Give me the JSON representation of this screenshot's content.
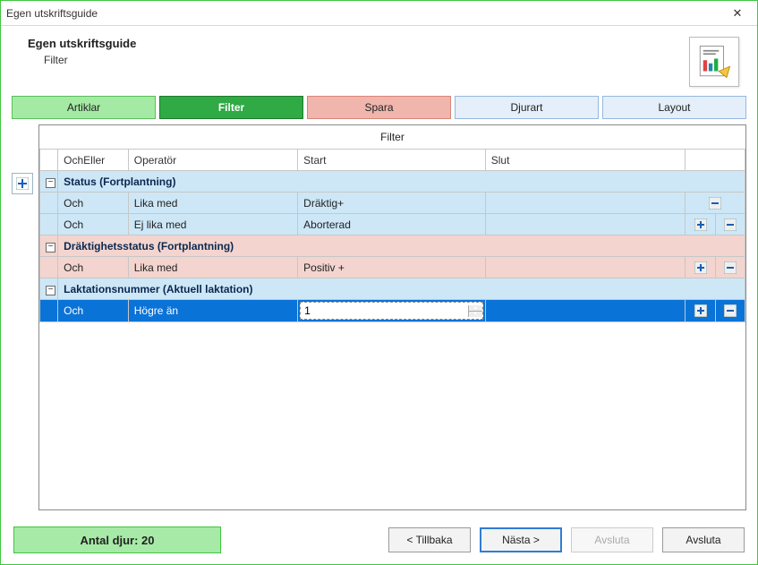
{
  "window": {
    "title": "Egen utskriftsguide"
  },
  "header": {
    "title": "Egen utskriftsguide",
    "sub": "Filter"
  },
  "tabs": {
    "artiklar": "Artiklar",
    "filter": "Filter",
    "spara": "Spara",
    "djurart": "Djurart",
    "layout": "Layout"
  },
  "grid": {
    "title": "Filter",
    "columns": {
      "ocheller": "OchEller",
      "operator": "Operatör",
      "start": "Start",
      "slut": "Slut"
    },
    "groups": [
      {
        "name": "Status (Fortplantning)",
        "theme": "blue",
        "rows": [
          {
            "ocheller": "Och",
            "operator": "Lika med",
            "start": "Dräktig+",
            "slut": "",
            "actions": [
              "minus"
            ]
          },
          {
            "ocheller": "Och",
            "operator": "Ej lika med",
            "start": "Aborterad",
            "slut": "",
            "actions": [
              "plus",
              "minus"
            ]
          }
        ]
      },
      {
        "name": "Dräktighetsstatus (Fortplantning)",
        "theme": "pink",
        "rows": [
          {
            "ocheller": "Och",
            "operator": "Lika med",
            "start": "Positiv +",
            "slut": "",
            "actions": [
              "plus",
              "minus"
            ]
          }
        ]
      },
      {
        "name": "Laktationsnummer (Aktuell laktation)",
        "theme": "blue",
        "rows": [
          {
            "ocheller": "Och",
            "operator": "Högre än",
            "start_input": "1",
            "slut": "",
            "actions": [
              "plus",
              "minus"
            ],
            "active": true
          }
        ]
      }
    ]
  },
  "footer": {
    "count_label": "Antal djur: 20",
    "back": "< Tillbaka",
    "next": "Nästa >",
    "finish_disabled": "Avsluta",
    "finish": "Avsluta"
  }
}
